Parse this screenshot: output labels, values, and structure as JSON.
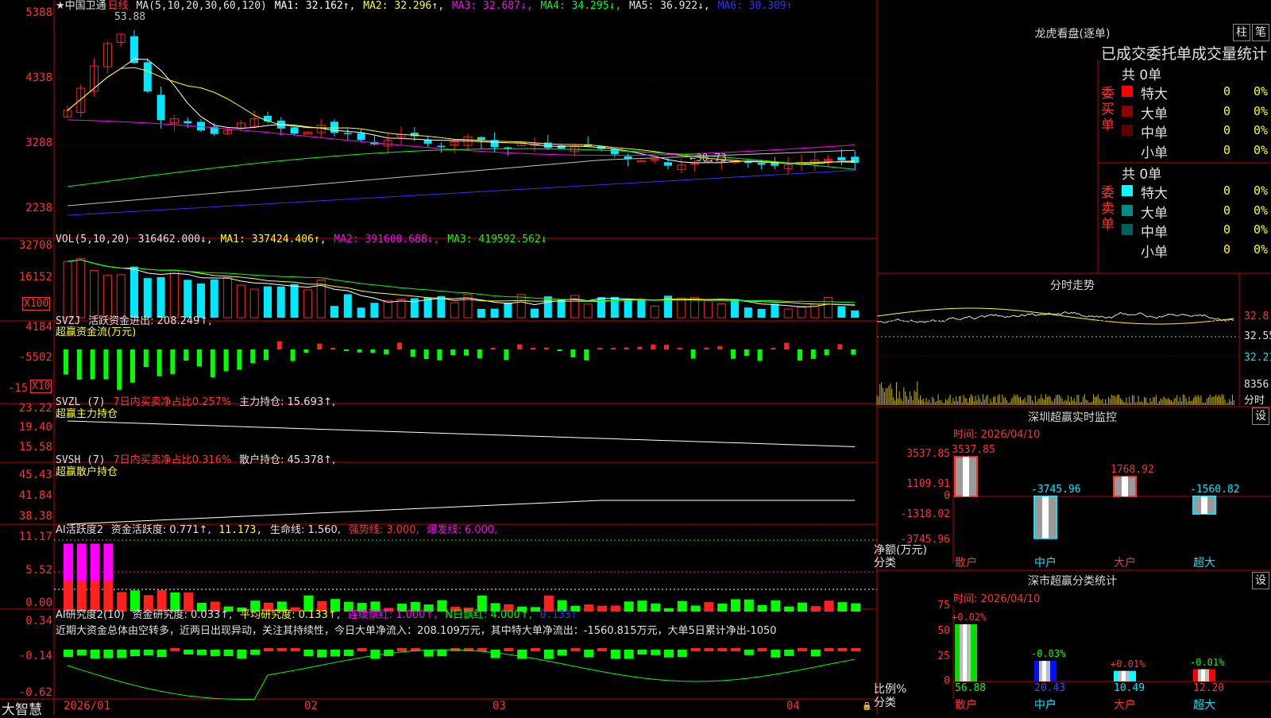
{
  "colors": {
    "up": "#ff2020",
    "down": "#00e8ff",
    "green": "#00ff00",
    "ma1": "#ffffff",
    "ma2": "#ffff00",
    "ma3": "#ff00ff",
    "ma4": "#00ff00",
    "ma5": "#c0c0c0",
    "ma6": "#3030ff",
    "grid": "#c00000"
  },
  "main": {
    "stock": "★中国卫通",
    "period": "日线",
    "ma_title": "MA(5,10,20,30,60,120)",
    "ma1": "MA1: 32.162↑,",
    "ma2": "MA2: 32.296↑,",
    "ma3": "MA3: 32.687↓,",
    "ma4": "MA4: 34.295↓,",
    "ma5": "MA5: 36.922↓,",
    "ma6": "MA6: 30.309↑",
    "y_labels": [
      "5388",
      "4338",
      "3288",
      "2238"
    ],
    "high_note": "53.88",
    "low_note": "←30.73"
  },
  "vol": {
    "title": "VOL(5,10,20)",
    "value": "316462.000↓,",
    "ma1": "MA1: 337424.406↑,",
    "ma2": "MA2: 391600.688↓,",
    "ma3": "MA3: 419592.562↓",
    "y_labels": [
      "32708",
      "16152"
    ],
    "unit": "X100"
  },
  "svzj": {
    "title": "SVZJ",
    "line": "活跃资金进出: 208.249↑,",
    "subtitle": "超赢资金流(万元)",
    "y_labels": [
      "4184",
      "-5502",
      "-15"
    ],
    "unit": "X10"
  },
  "svzl": {
    "title": "SVZL (7)",
    "ratio": "7日内买卖净占比0.257%",
    "hold": "主力持仓: 15.693↑,",
    "subtitle": "超赢主力持仓",
    "y_labels": [
      "23.22",
      "19.40",
      "15.58"
    ]
  },
  "svsh": {
    "title": "SVSH (7)",
    "ratio": "7日内买卖净占比0.316%",
    "hold": "散户持仓: 45.378↑,",
    "subtitle": "超赢散户持仓",
    "y_labels": [
      "45.43",
      "41.84",
      "38.38"
    ]
  },
  "ai1": {
    "title": "AI活跃度2",
    "activity": "资金活跃度: 0.771↑,",
    "v2": "11.173,",
    "life": "生命线: 1.560,",
    "strong": "强势线: 3.000,",
    "burst": "爆发线: 6.000,",
    "y_labels": [
      "11.17",
      "5.52",
      "0.00"
    ]
  },
  "ai2": {
    "title": "AI研究度2(10)",
    "research": "资金研究度: 0.033↑,",
    "avg": "平均研究度: 0.133↑,",
    "cont": "连续飘红: 1.000↑,",
    "nday": "N日飘红: 4.000↑,",
    "last": "0.133↑",
    "note": "近期大资金总体由空转多，近两日出现异动，关注其持续性，今日大单净流入：208.109万元，其中特大单净流出：-1560.815万元，大单5日累计净出-1050",
    "y_labels": [
      "0.34",
      "-0.14",
      "-0.62"
    ]
  },
  "xaxis": [
    "2026/01",
    "02",
    "03",
    "04"
  ],
  "brand": "大智慧",
  "right": {
    "lhb_title": "龙虎看盘(逐单)",
    "btn1": "柱",
    "btn2": "笔",
    "stats_title": "已成交委托单成交量统计",
    "buy": {
      "header": "共 0单",
      "side": "委买单",
      "rows": [
        {
          "name": "特大",
          "val": "0",
          "pct": "0%",
          "color": "#ff0000"
        },
        {
          "name": "大单",
          "val": "0",
          "pct": "0%",
          "color": "#8b0000"
        },
        {
          "name": "中单",
          "val": "0",
          "pct": "0%",
          "color": "#5a0000"
        },
        {
          "name": "小单",
          "val": "0",
          "pct": "0%",
          "color": "#000000"
        }
      ]
    },
    "sell": {
      "header": "共 0单",
      "side": "委卖单",
      "rows": [
        {
          "name": "特大",
          "val": "0",
          "pct": "0%",
          "color": "#00ffff"
        },
        {
          "name": "大单",
          "val": "0",
          "pct": "0%",
          "color": "#008b8b"
        },
        {
          "name": "中单",
          "val": "0",
          "pct": "0%",
          "color": "#006060"
        },
        {
          "name": "小单",
          "val": "0",
          "pct": "0%",
          "color": "#000000"
        }
      ]
    },
    "fs_title": "分时走势",
    "fs_labels": [
      "32.8",
      "32.55",
      "32.21"
    ],
    "fs_vol": "8356",
    "fs_unit": "分时",
    "mon_title": "深圳超赢实时监控",
    "mon_btn": "设",
    "mon_time": "时间: 2026/04/10",
    "mon_y": [
      "3537.85",
      "1109.91",
      "0",
      "-1318.02",
      "-3745.96"
    ],
    "mon_ylabel": "净额(万元)",
    "mon_cat_label": "分类",
    "mon_cats": [
      "散户",
      "中户",
      "大户",
      "超大"
    ],
    "mon_vals": [
      "3537.85",
      "-3745.96",
      "1768.92",
      "-1560.82"
    ],
    "cls_title": "深市超赢分类统计",
    "cls_btn": "设",
    "cls_time": "时间: 2026/04/10",
    "cls_y": [
      "75",
      "50",
      "25",
      "0"
    ],
    "cls_ylabel": "比例%",
    "cls_cat_label": "分类",
    "cls_cats": [
      "散户",
      "中户",
      "大户",
      "超大"
    ],
    "cls_pct": [
      "+0.02%",
      "-0.03%",
      "+0.01%",
      "-0.01%"
    ],
    "cls_vals": [
      "56.88",
      "20.43",
      "10.49",
      "12.20"
    ]
  },
  "chart_data": [
    {
      "type": "bar",
      "title": "深圳超赢实时监控",
      "categories": [
        "散户",
        "中户",
        "大户",
        "超大"
      ],
      "values": [
        3537.85,
        -3745.96,
        1768.92,
        -1560.82
      ],
      "ylabel": "净额(万元)",
      "ylim": [
        -3745.96,
        3537.85
      ]
    },
    {
      "type": "bar",
      "title": "深市超赢分类统计",
      "categories": [
        "散户",
        "中户",
        "大户",
        "超大"
      ],
      "values": [
        56.88,
        20.43,
        10.49,
        12.2
      ],
      "changes": [
        "+0.02%",
        "-0.03%",
        "+0.01%",
        "-0.01%"
      ],
      "ylabel": "比例%",
      "ylim": [
        0,
        75
      ]
    }
  ]
}
